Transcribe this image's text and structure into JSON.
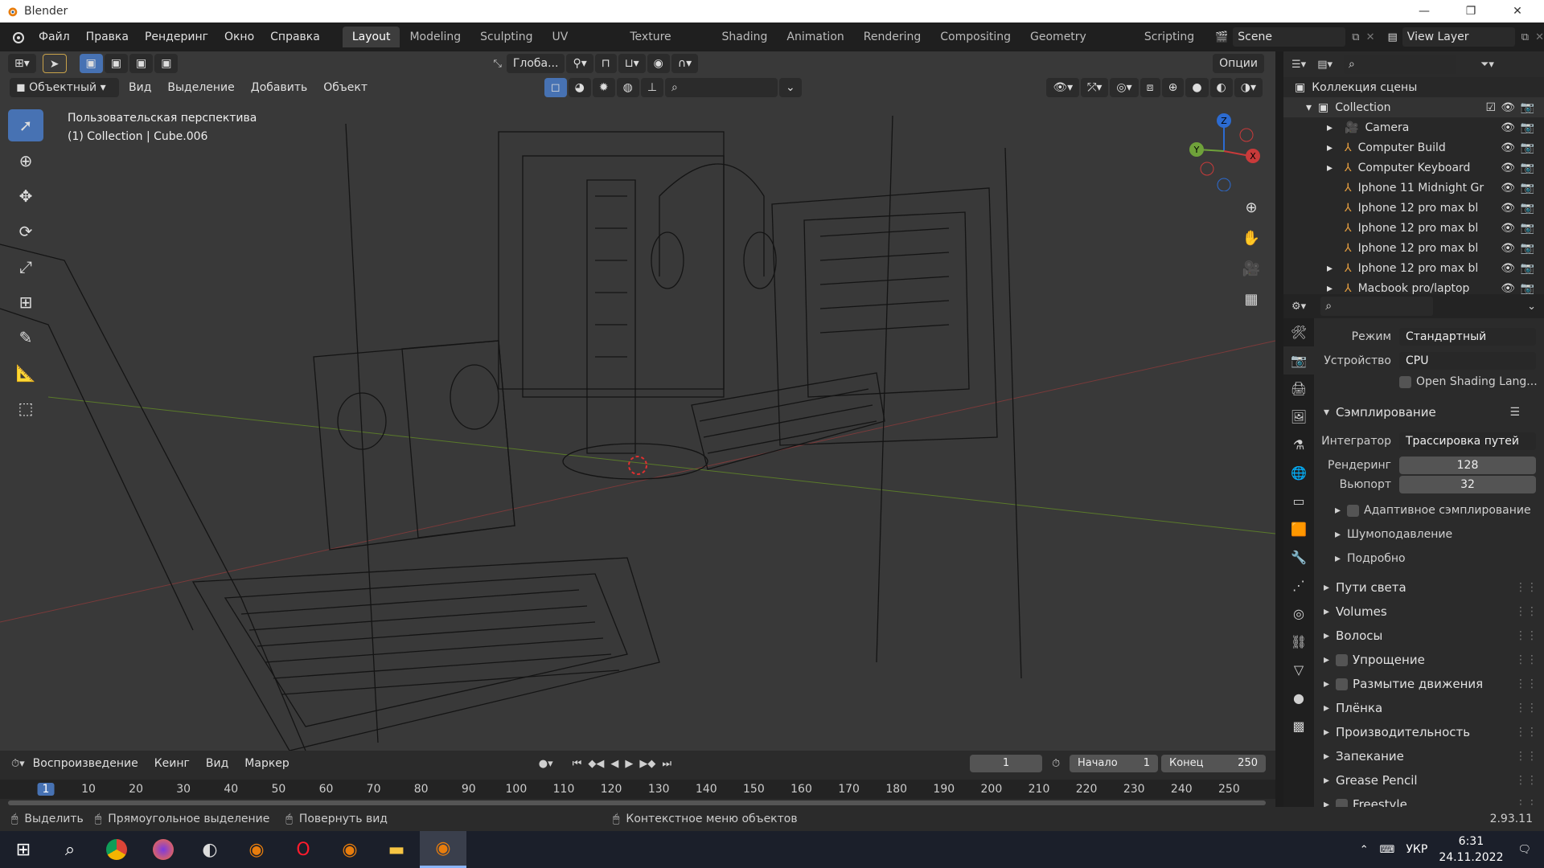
{
  "window": {
    "title": "Blender",
    "minimize": "—",
    "maximize": "❐",
    "close": "✕"
  },
  "menu": {
    "items": [
      "Файл",
      "Правка",
      "Рендеринг",
      "Окно",
      "Справка"
    ]
  },
  "workspaces": [
    "Layout",
    "Modeling",
    "Sculpting",
    "UV Editing",
    "Texture Paint",
    "Shading",
    "Animation",
    "Rendering",
    "Compositing",
    "Geometry Nodes",
    "Scripting"
  ],
  "workspace_active": "Layout",
  "scene": {
    "name": "Scene",
    "view_layer": "View Layer"
  },
  "viewport": {
    "transform_orientation": "Глоба...",
    "options_label": "Опции",
    "mode": "Объектный",
    "menu": [
      "Вид",
      "Выделение",
      "Добавить",
      "Объект"
    ],
    "info_line1": "Пользовательская перспектива",
    "info_line2": "(1) Collection | Cube.006",
    "axis_z": "Z",
    "axis_y": "Y",
    "axis_x": "X"
  },
  "outliner": {
    "title": "Коллекция сцены",
    "collection": "Collection",
    "items": [
      "Camera",
      "Computer Build",
      "Computer Keyboard",
      "Iphone 11 Midnight Gr",
      "Iphone 12 pro max bl",
      "Iphone 12 pro max bl",
      "Iphone 12 pro max bl",
      "Iphone 12 pro max bl",
      "Macbook pro/laptop"
    ]
  },
  "properties": {
    "mode_label": "Режим",
    "mode_value": "Стандартный",
    "device_label": "Устройство",
    "device_value": "CPU",
    "osl_label": "Open Shading Lang...",
    "sampling": "Сэмплирование",
    "integrator_label": "Интегратор",
    "integrator_value": "Трассировка путей",
    "render_label": "Рендеринг",
    "render_value": "128",
    "viewport_label": "Вьюпорт",
    "viewport_value": "32",
    "sub": [
      "Адаптивное сэмплирование",
      "Шумоподавление",
      "Подробно"
    ],
    "sections": [
      "Пути света",
      "Volumes",
      "Волосы",
      "Упрощение",
      "Размытие движения",
      "Плёнка",
      "Производительность",
      "Запекание",
      "Grease Pencil",
      "Freestyle"
    ]
  },
  "timeline": {
    "menu": [
      "Воспроизведение",
      "Кеинг",
      "Вид",
      "Маркер"
    ],
    "current_frame": "1",
    "start_label": "Начало",
    "start_value": "1",
    "end_label": "Конец",
    "end_value": "250",
    "ticks": [
      "1",
      "10",
      "20",
      "30",
      "40",
      "50",
      "60",
      "70",
      "80",
      "90",
      "100",
      "110",
      "120",
      "130",
      "140",
      "150",
      "160",
      "170",
      "180",
      "190",
      "200",
      "210",
      "220",
      "230",
      "240",
      "250"
    ]
  },
  "status": {
    "select": "Выделить",
    "box_select": "Прямоугольное выделение",
    "rotate": "Повернуть вид",
    "context": "Контекстное меню объектов",
    "version": "2.93.11"
  },
  "taskbar": {
    "lang": "УКР",
    "time": "6:31",
    "date": "24.11.2022"
  }
}
